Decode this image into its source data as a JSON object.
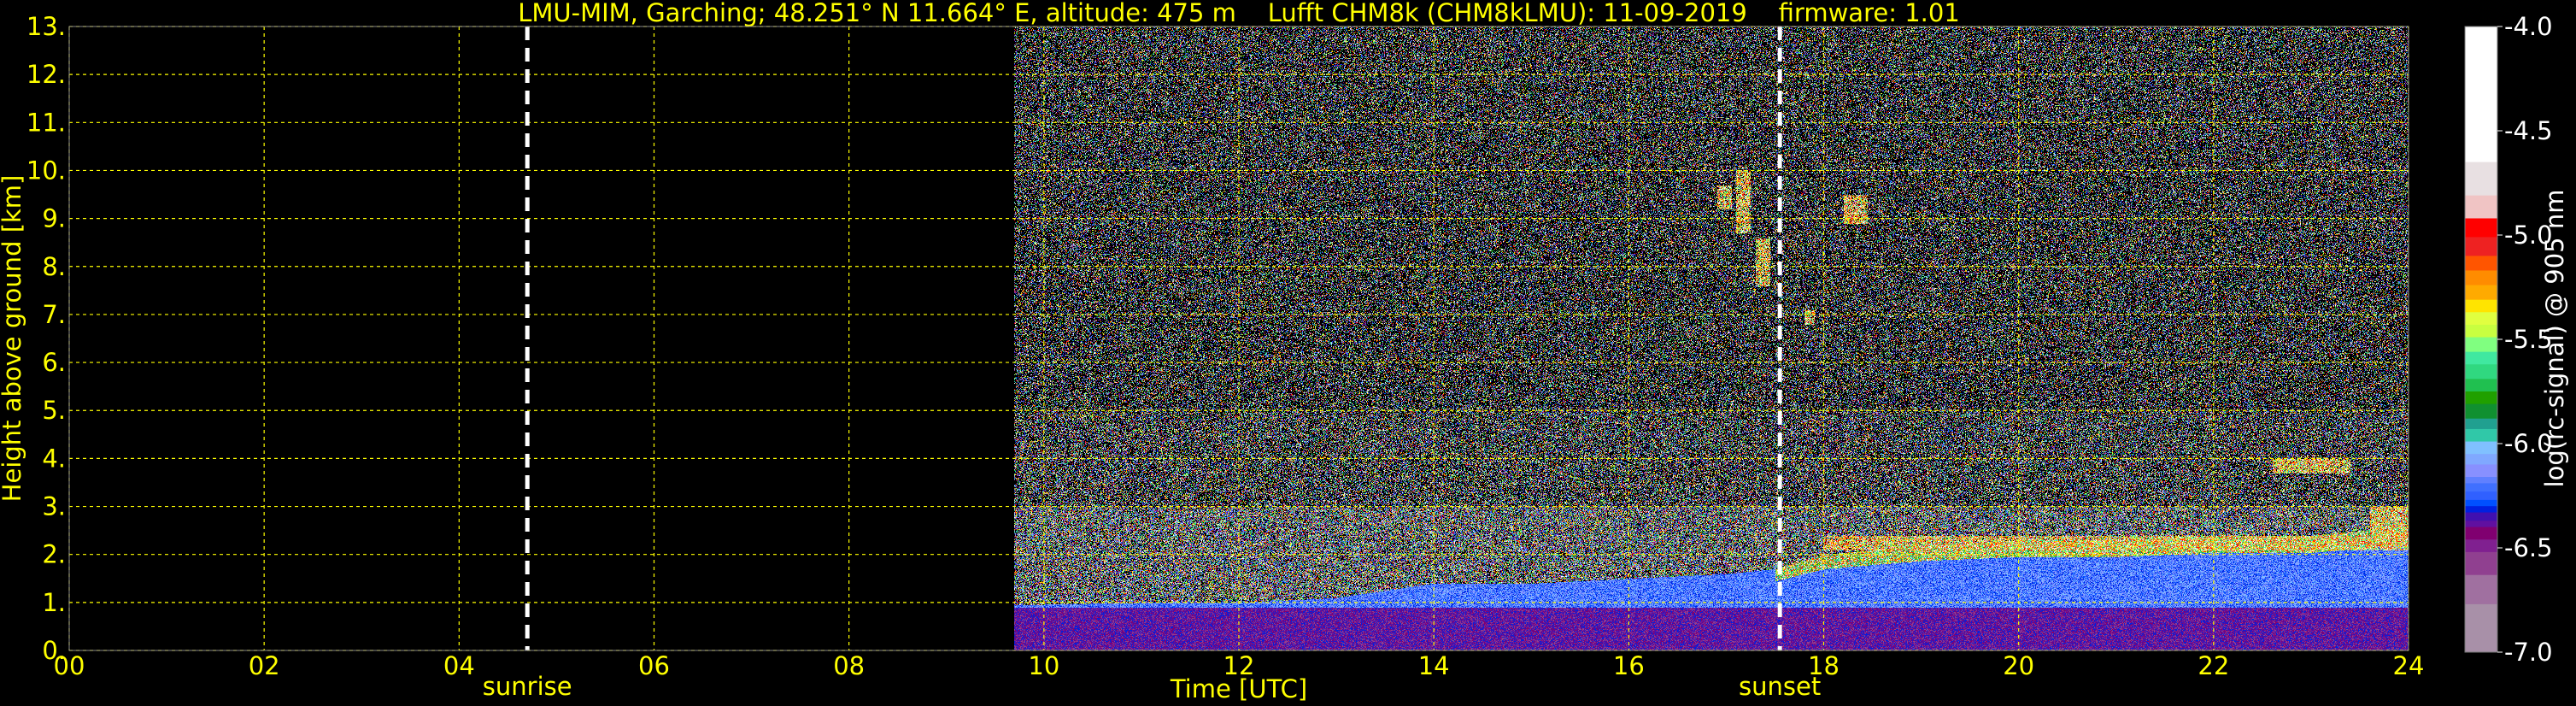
{
  "chart_data": {
    "type": "heatmap",
    "title": "LMU-MIM, Garching; 48.251° N 11.664° E, altitude: 475 m    Lufft CHM8k (CHM8kLMU): 11-09-2019    firmware: 1.01",
    "xlabel": "Time [UTC]",
    "ylabel": "Height above ground [km]",
    "xlim": [
      0,
      24
    ],
    "ylim": [
      0,
      13
    ],
    "grid": true,
    "xticks": [
      0,
      2,
      4,
      6,
      8,
      10,
      12,
      14,
      16,
      18,
      20,
      22,
      24
    ],
    "xtick_labels": [
      "00",
      "02",
      "04",
      "06",
      "08",
      "10",
      "12",
      "14",
      "16",
      "18",
      "20",
      "22",
      "24"
    ],
    "yticks": [
      0,
      1,
      2,
      3,
      4,
      5,
      6,
      7,
      8,
      9,
      10,
      11,
      12,
      13
    ],
    "ytick_labels": [
      "0.",
      "1.",
      "2.",
      "3.",
      "4.",
      "5.",
      "6.",
      "7.",
      "8.",
      "9.",
      "10.",
      "11.",
      "12.",
      "13."
    ],
    "data_start_hour": 9.7,
    "annotations": [
      {
        "label": "sunrise",
        "hour": 4.7
      },
      {
        "label": "sunset",
        "hour": 17.55
      }
    ],
    "boundary_layer_top_km": {
      "hours": [
        9.7,
        11,
        12,
        13,
        14,
        15,
        16,
        17,
        17.5,
        18,
        19,
        20,
        21,
        22,
        23,
        24
      ],
      "values": [
        0.95,
        1.0,
        1.0,
        1.1,
        1.4,
        1.4,
        1.5,
        1.6,
        1.7,
        2.0,
        2.2,
        2.3,
        2.3,
        2.4,
        2.4,
        2.6
      ]
    },
    "clouds": [
      {
        "t0": 16.9,
        "t1": 17.05,
        "h0": 9.2,
        "h1": 9.7
      },
      {
        "t0": 17.1,
        "t1": 17.25,
        "h0": 8.7,
        "h1": 10.0
      },
      {
        "t0": 17.3,
        "t1": 17.45,
        "h0": 7.6,
        "h1": 8.6
      },
      {
        "t0": 17.8,
        "t1": 17.9,
        "h0": 6.8,
        "h1": 7.1
      },
      {
        "t0": 18.2,
        "t1": 18.45,
        "h0": 8.9,
        "h1": 9.5
      },
      {
        "t0": 18.0,
        "t1": 24,
        "h0": 2.1,
        "h1": 2.4
      },
      {
        "t0": 22.6,
        "t1": 23.4,
        "h0": 3.7,
        "h1": 4.0
      },
      {
        "t0": 23.6,
        "t1": 24,
        "h0": 2.3,
        "h1": 3.0
      }
    ],
    "colorbar": {
      "label": "log(rc-signal) @ 905 nm",
      "range": [
        -7.0,
        -4.0
      ],
      "ticks": [
        -4.0,
        -4.5,
        -5.0,
        -5.5,
        -6.0,
        -6.5,
        -7.0
      ],
      "tick_labels": [
        "-4.0",
        "-4.5",
        "-5.0",
        "-5.5",
        "-6.0",
        "-6.5",
        "-7.0"
      ],
      "levels": [
        {
          "from": -4.65,
          "to": -4.0,
          "color": "#ffffff"
        },
        {
          "from": -4.81,
          "to": -4.65,
          "color": "#e8e0e2"
        },
        {
          "from": -4.92,
          "to": -4.81,
          "color": "#f0c4c4"
        },
        {
          "from": -5.01,
          "to": -4.92,
          "color": "#ff0000"
        },
        {
          "from": -5.1,
          "to": -5.01,
          "color": "#ee2222"
        },
        {
          "from": -5.17,
          "to": -5.1,
          "color": "#ff5500"
        },
        {
          "from": -5.24,
          "to": -5.17,
          "color": "#ff8c00"
        },
        {
          "from": -5.31,
          "to": -5.24,
          "color": "#ffaa00"
        },
        {
          "from": -5.37,
          "to": -5.31,
          "color": "#ffe400"
        },
        {
          "from": -5.43,
          "to": -5.37,
          "color": "#e0ff40"
        },
        {
          "from": -5.49,
          "to": -5.43,
          "color": "#c8ff40"
        },
        {
          "from": -5.56,
          "to": -5.49,
          "color": "#80ff80"
        },
        {
          "from": -5.62,
          "to": -5.56,
          "color": "#40e8a0"
        },
        {
          "from": -5.69,
          "to": -5.62,
          "color": "#30d880"
        },
        {
          "from": -5.75,
          "to": -5.69,
          "color": "#20c050"
        },
        {
          "from": -5.81,
          "to": -5.75,
          "color": "#20a000"
        },
        {
          "from": -5.88,
          "to": -5.81,
          "color": "#109030"
        },
        {
          "from": -5.93,
          "to": -5.88,
          "color": "#20a090"
        },
        {
          "from": -5.99,
          "to": -5.93,
          "color": "#30c8a8"
        },
        {
          "from": -6.05,
          "to": -5.99,
          "color": "#80c0ff"
        },
        {
          "from": -6.1,
          "to": -6.05,
          "color": "#80a8ff"
        },
        {
          "from": -6.16,
          "to": -6.1,
          "color": "#8890ff"
        },
        {
          "from": -6.19,
          "to": -6.16,
          "color": "#6080ff"
        },
        {
          "from": -6.23,
          "to": -6.19,
          "color": "#4070ff"
        },
        {
          "from": -6.27,
          "to": -6.23,
          "color": "#3060ff"
        },
        {
          "from": -6.3,
          "to": -6.27,
          "color": "#0050ff"
        },
        {
          "from": -6.33,
          "to": -6.3,
          "color": "#0020e0"
        },
        {
          "from": -6.37,
          "to": -6.33,
          "color": "#4010b0"
        },
        {
          "from": -6.4,
          "to": -6.37,
          "color": "#6010a0"
        },
        {
          "from": -6.46,
          "to": -6.4,
          "color": "#800070"
        },
        {
          "from": -6.52,
          "to": -6.46,
          "color": "#802090"
        },
        {
          "from": -6.63,
          "to": -6.52,
          "color": "#904090"
        },
        {
          "from": -6.77,
          "to": -6.63,
          "color": "#a070a0"
        },
        {
          "from": -7.0,
          "to": -6.77,
          "color": "#a890a8"
        }
      ]
    }
  }
}
